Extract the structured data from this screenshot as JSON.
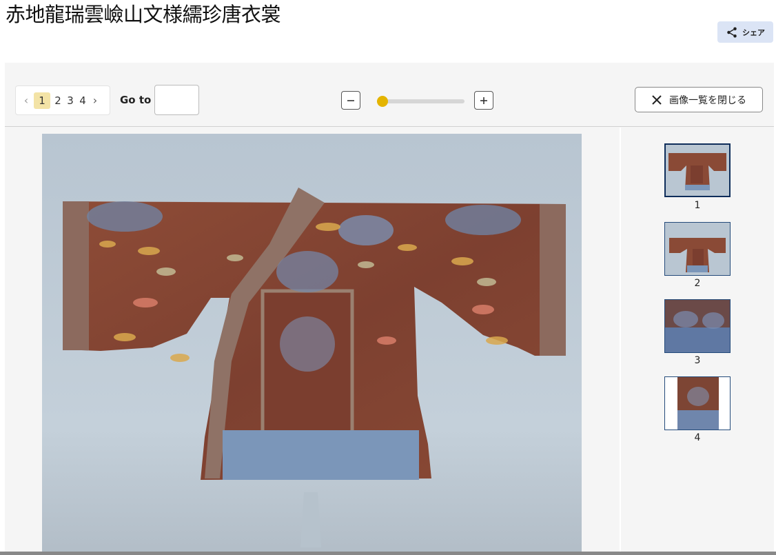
{
  "title": "赤地龍瑞雲嶮山文様繻珍唐衣裳",
  "share": {
    "label": "シェア",
    "icon": "share-icon"
  },
  "pager": {
    "prev_icon": "chevron-left-icon",
    "next_icon": "chevron-right-icon",
    "pages": [
      "1",
      "2",
      "3",
      "4"
    ],
    "current": 1
  },
  "goto": {
    "label": "Go to",
    "value": ""
  },
  "zoom": {
    "minus_icon": "minus-icon",
    "plus_icon": "plus-icon",
    "level": 0
  },
  "close_list": {
    "label": "画像一覧を閉じる",
    "icon": "close-icon"
  },
  "thumbnails": [
    {
      "num": "1",
      "selected": true
    },
    {
      "num": "2",
      "selected": false
    },
    {
      "num": "3",
      "selected": false
    },
    {
      "num": "4",
      "selected": false
    }
  ],
  "colors": {
    "accent": "#e4b400",
    "share_bg": "#dbe4f5",
    "robe": "#8a4a36",
    "thumb_border": "#0e2d5a"
  }
}
